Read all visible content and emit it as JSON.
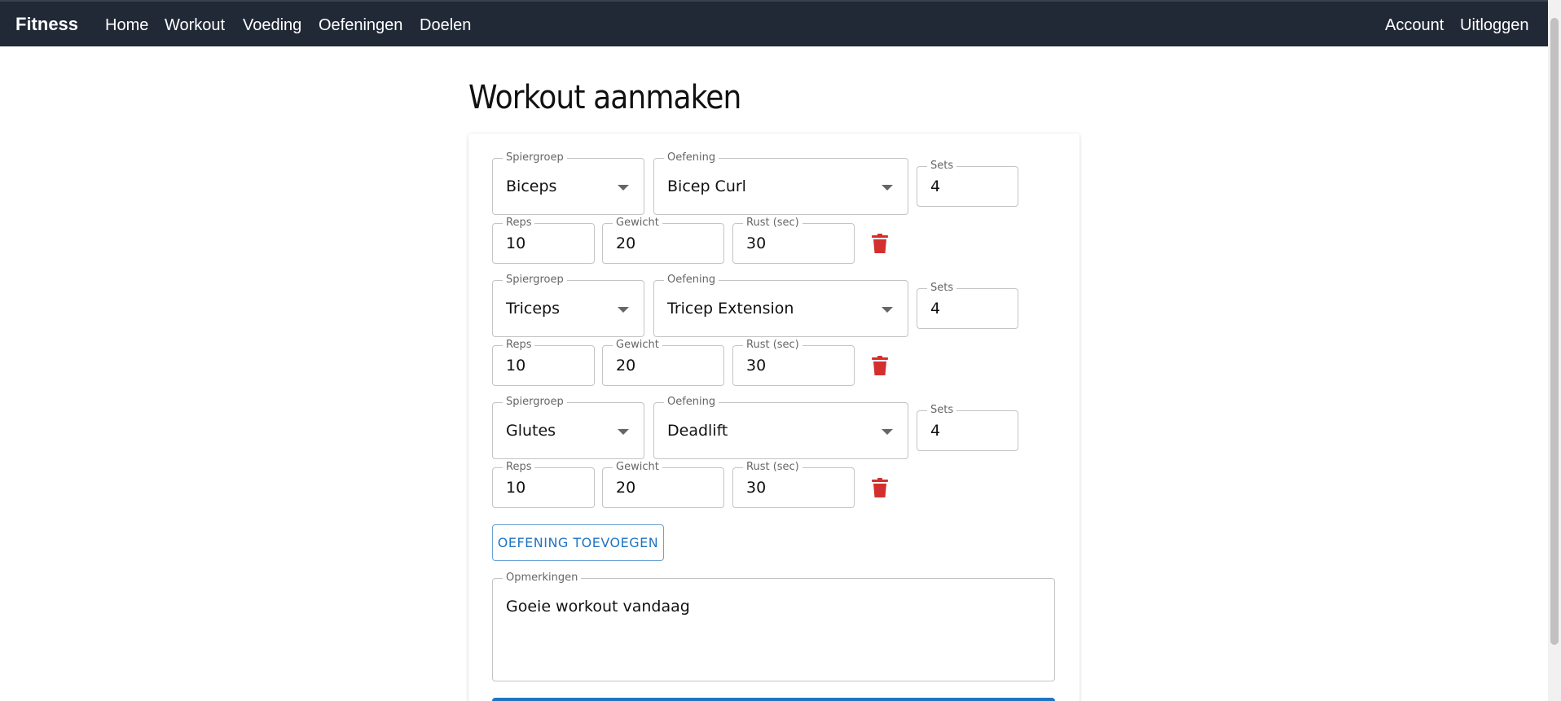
{
  "nav": {
    "brand": "Fitness",
    "links": [
      "Home",
      "Workout",
      "Voeding",
      "Oefeningen",
      "Doelen"
    ],
    "right_links": [
      "Account",
      "Uitloggen"
    ]
  },
  "page": {
    "title": "Workout aanmaken"
  },
  "labels": {
    "muscle_group": "Spiergroep",
    "exercise": "Oefening",
    "sets": "Sets",
    "reps": "Reps",
    "weight": "Gewicht",
    "rest": "Rust (sec)",
    "notes": "Opmerkingen"
  },
  "exercises": [
    {
      "muscle_group": "Biceps",
      "exercise": "Bicep Curl",
      "sets": "4",
      "reps": "10",
      "weight": "20",
      "rest": "30"
    },
    {
      "muscle_group": "Triceps",
      "exercise": "Tricep Extension",
      "sets": "4",
      "reps": "10",
      "weight": "20",
      "rest": "30"
    },
    {
      "muscle_group": "Glutes",
      "exercise": "Deadlift",
      "sets": "4",
      "reps": "10",
      "weight": "20",
      "rest": "30"
    }
  ],
  "add_button_label": "OEFENING TOEVOEGEN",
  "notes_value": "Goeie workout vandaag",
  "colors": {
    "navbar": "#212936",
    "primary": "#1f74c6",
    "delete": "#d32f2f"
  },
  "icons": {
    "delete": "trash-icon",
    "dropdown": "caret-down-icon"
  }
}
